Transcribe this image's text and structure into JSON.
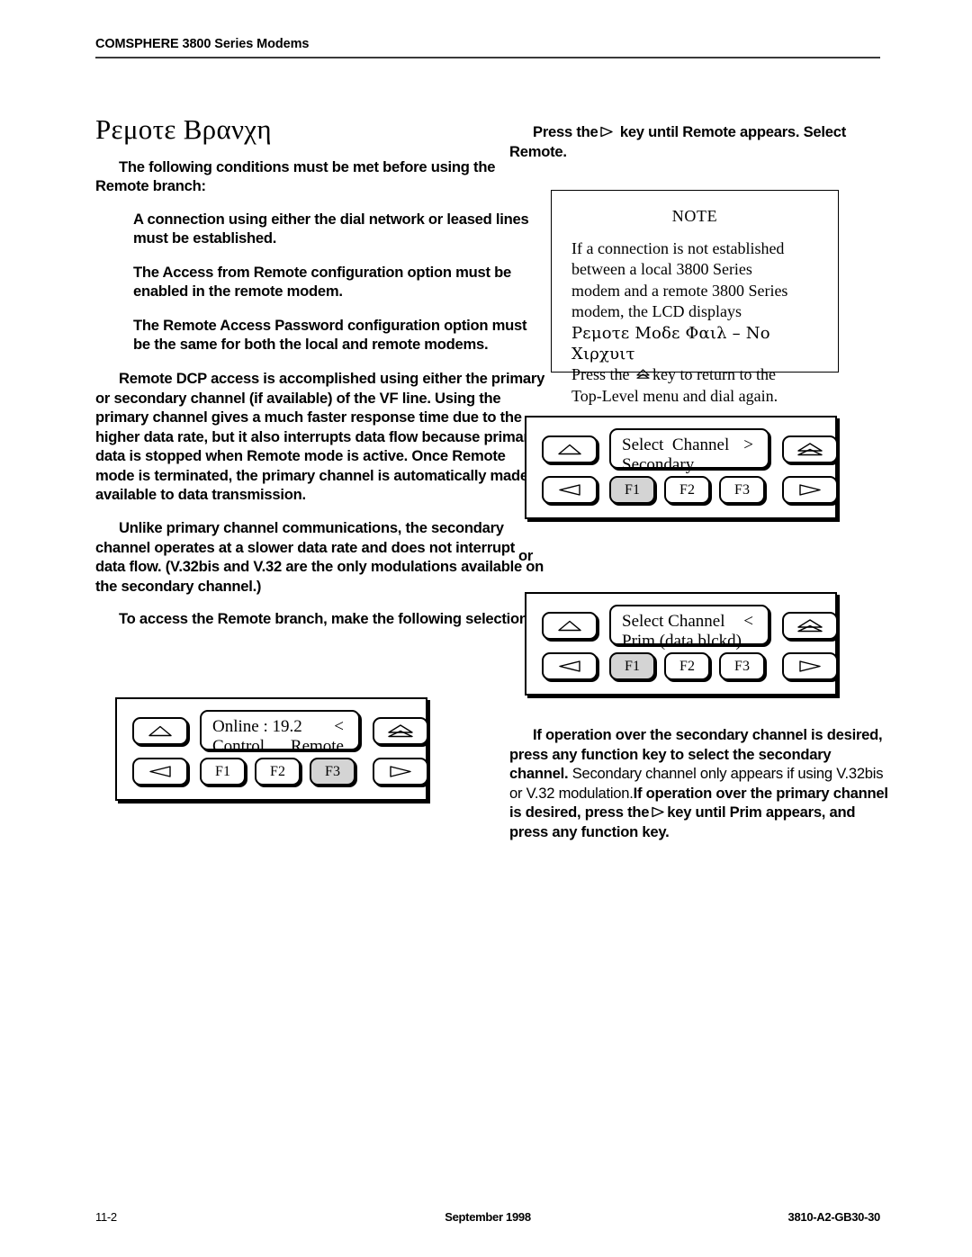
{
  "running_head": {
    "text": "COMSPHERE 3800 Series Modems"
  },
  "left_column": {
    "title": "Ρεμοτε Βρανχη",
    "intro": "The following conditions must be met before using the Remote branch:",
    "conditions": [
      "A connection using either the dial network or leased lines must be established.",
      "The Access from Remote configuration option must be enabled in the remote modem.",
      "The Remote Access Password configuration option must be the same for both the local and remote modems."
    ],
    "dcp_paragraph": "Remote DCP access is accomplished using either the primary or secondary channel (if available) of the VF line. Using the primary channel gives a much faster response time due to the higher data rate, but it also interrupts data flow because primary data is stopped when Remote mode is active. Once Remote mode is terminated, the primary channel is automatically made available to data transmission.",
    "secondary_paragraph": "Unlike primary channel communications, the secondary channel operates at a slower data rate and does not interrupt data flow. (V.32bis and V.32 are the only modulations available on the secondary channel.)",
    "access_paragraph": "To access the Remote branch, make the following selections:"
  },
  "right_column": {
    "press_key_lead_a": "Press the",
    "press_key_lead_b": "key until Remote appears. Select Remote.",
    "note": {
      "title": "NOTE",
      "lines": [
        "If a connection is not established",
        "between a local 3800 Series",
        "modem and a remote 3800 Series",
        "modem, the LCD displays"
      ],
      "lcd_message": "Ρεμοτε Μοδε Φαιλ  – Νο Χιρχυιτ",
      "press_a": "Press the",
      "press_b": "key to return to the",
      "press_c": "Top-Level menu and dial again."
    },
    "closing": {
      "bold_a": "If operation over the secondary channel is desired, press any function key to select the secondary channel.",
      "plain_b": "Secondary channel only appears if using V.32bis or V.32 modulation.",
      "bold_c1": "If operation over the primary channel is desired, press the",
      "bold_c2": "key until Prim appears, and press any function key."
    }
  },
  "or_connector": {
    "label": "or"
  },
  "panels": [
    {
      "id": "panel-online-remote",
      "lcd": {
        "line1_left": "Online : 19.2",
        "line1_right": "<",
        "line2_left": "Control",
        "line2_right": "Remote"
      },
      "function_keys": [
        {
          "label": "F1",
          "selected": false
        },
        {
          "label": "F2",
          "selected": false
        },
        {
          "label": "F3",
          "selected": true
        }
      ],
      "nav_keys": {
        "up": "up-arrow-key",
        "home": "home-key",
        "left": "left-arrow-key",
        "right": "right-arrow-key"
      }
    },
    {
      "id": "panel-select-channel-secondary",
      "lcd": {
        "line1_left": "Select  Channel",
        "line1_right": ">",
        "line2_left": "Secondary",
        "line2_right": ""
      },
      "function_keys": [
        {
          "label": "F1",
          "selected": true
        },
        {
          "label": "F2",
          "selected": false
        },
        {
          "label": "F3",
          "selected": false
        }
      ],
      "nav_keys": {
        "up": "up-arrow-key",
        "home": "home-key",
        "left": "left-arrow-key",
        "right": "right-arrow-key"
      }
    },
    {
      "id": "panel-select-channel-prim",
      "lcd": {
        "line1_left": "Select Channel",
        "line1_right": "<",
        "line2_left": "Prim (data blckd)",
        "line2_right": ""
      },
      "function_keys": [
        {
          "label": "F1",
          "selected": true
        },
        {
          "label": "F2",
          "selected": false
        },
        {
          "label": "F3",
          "selected": false
        }
      ],
      "nav_keys": {
        "up": "up-arrow-key",
        "home": "home-key",
        "left": "left-arrow-key",
        "right": "right-arrow-key"
      }
    }
  ],
  "footer": {
    "page_number": "11-2",
    "date": "September 1998",
    "doc_number": "3810-A2-GB30-30"
  }
}
